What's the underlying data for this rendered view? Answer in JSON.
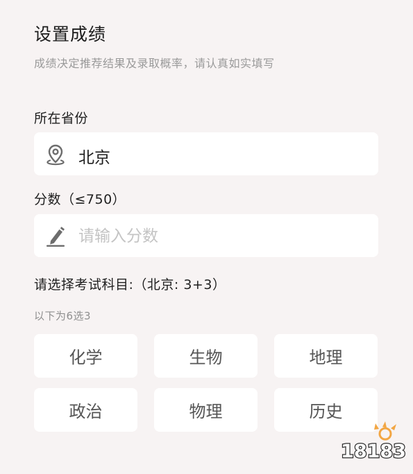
{
  "header": {
    "title": "设置成绩",
    "subtitle": "成绩决定推荐结果及录取概率，请认真如实填写"
  },
  "province": {
    "label": "所在省份",
    "value": "北京",
    "icon": "location-pin-icon"
  },
  "score": {
    "label": "分数（≤750）",
    "placeholder": "请输入分数",
    "value": "",
    "icon": "pencil-icon"
  },
  "subjects": {
    "label": "请选择考试科目:（北京: 3+3）",
    "hint": "以下为6选3",
    "options": [
      "化学",
      "生物",
      "地理",
      "政治",
      "物理",
      "历史"
    ]
  },
  "watermark": {
    "text": "18183",
    "icon": "18183-logo-icon"
  },
  "colors": {
    "background": "#f7f3f3",
    "card": "#ffffff",
    "placeholder": "#c4c4c4",
    "subtitle": "#9a9a9a",
    "chip_text": "#555555"
  }
}
